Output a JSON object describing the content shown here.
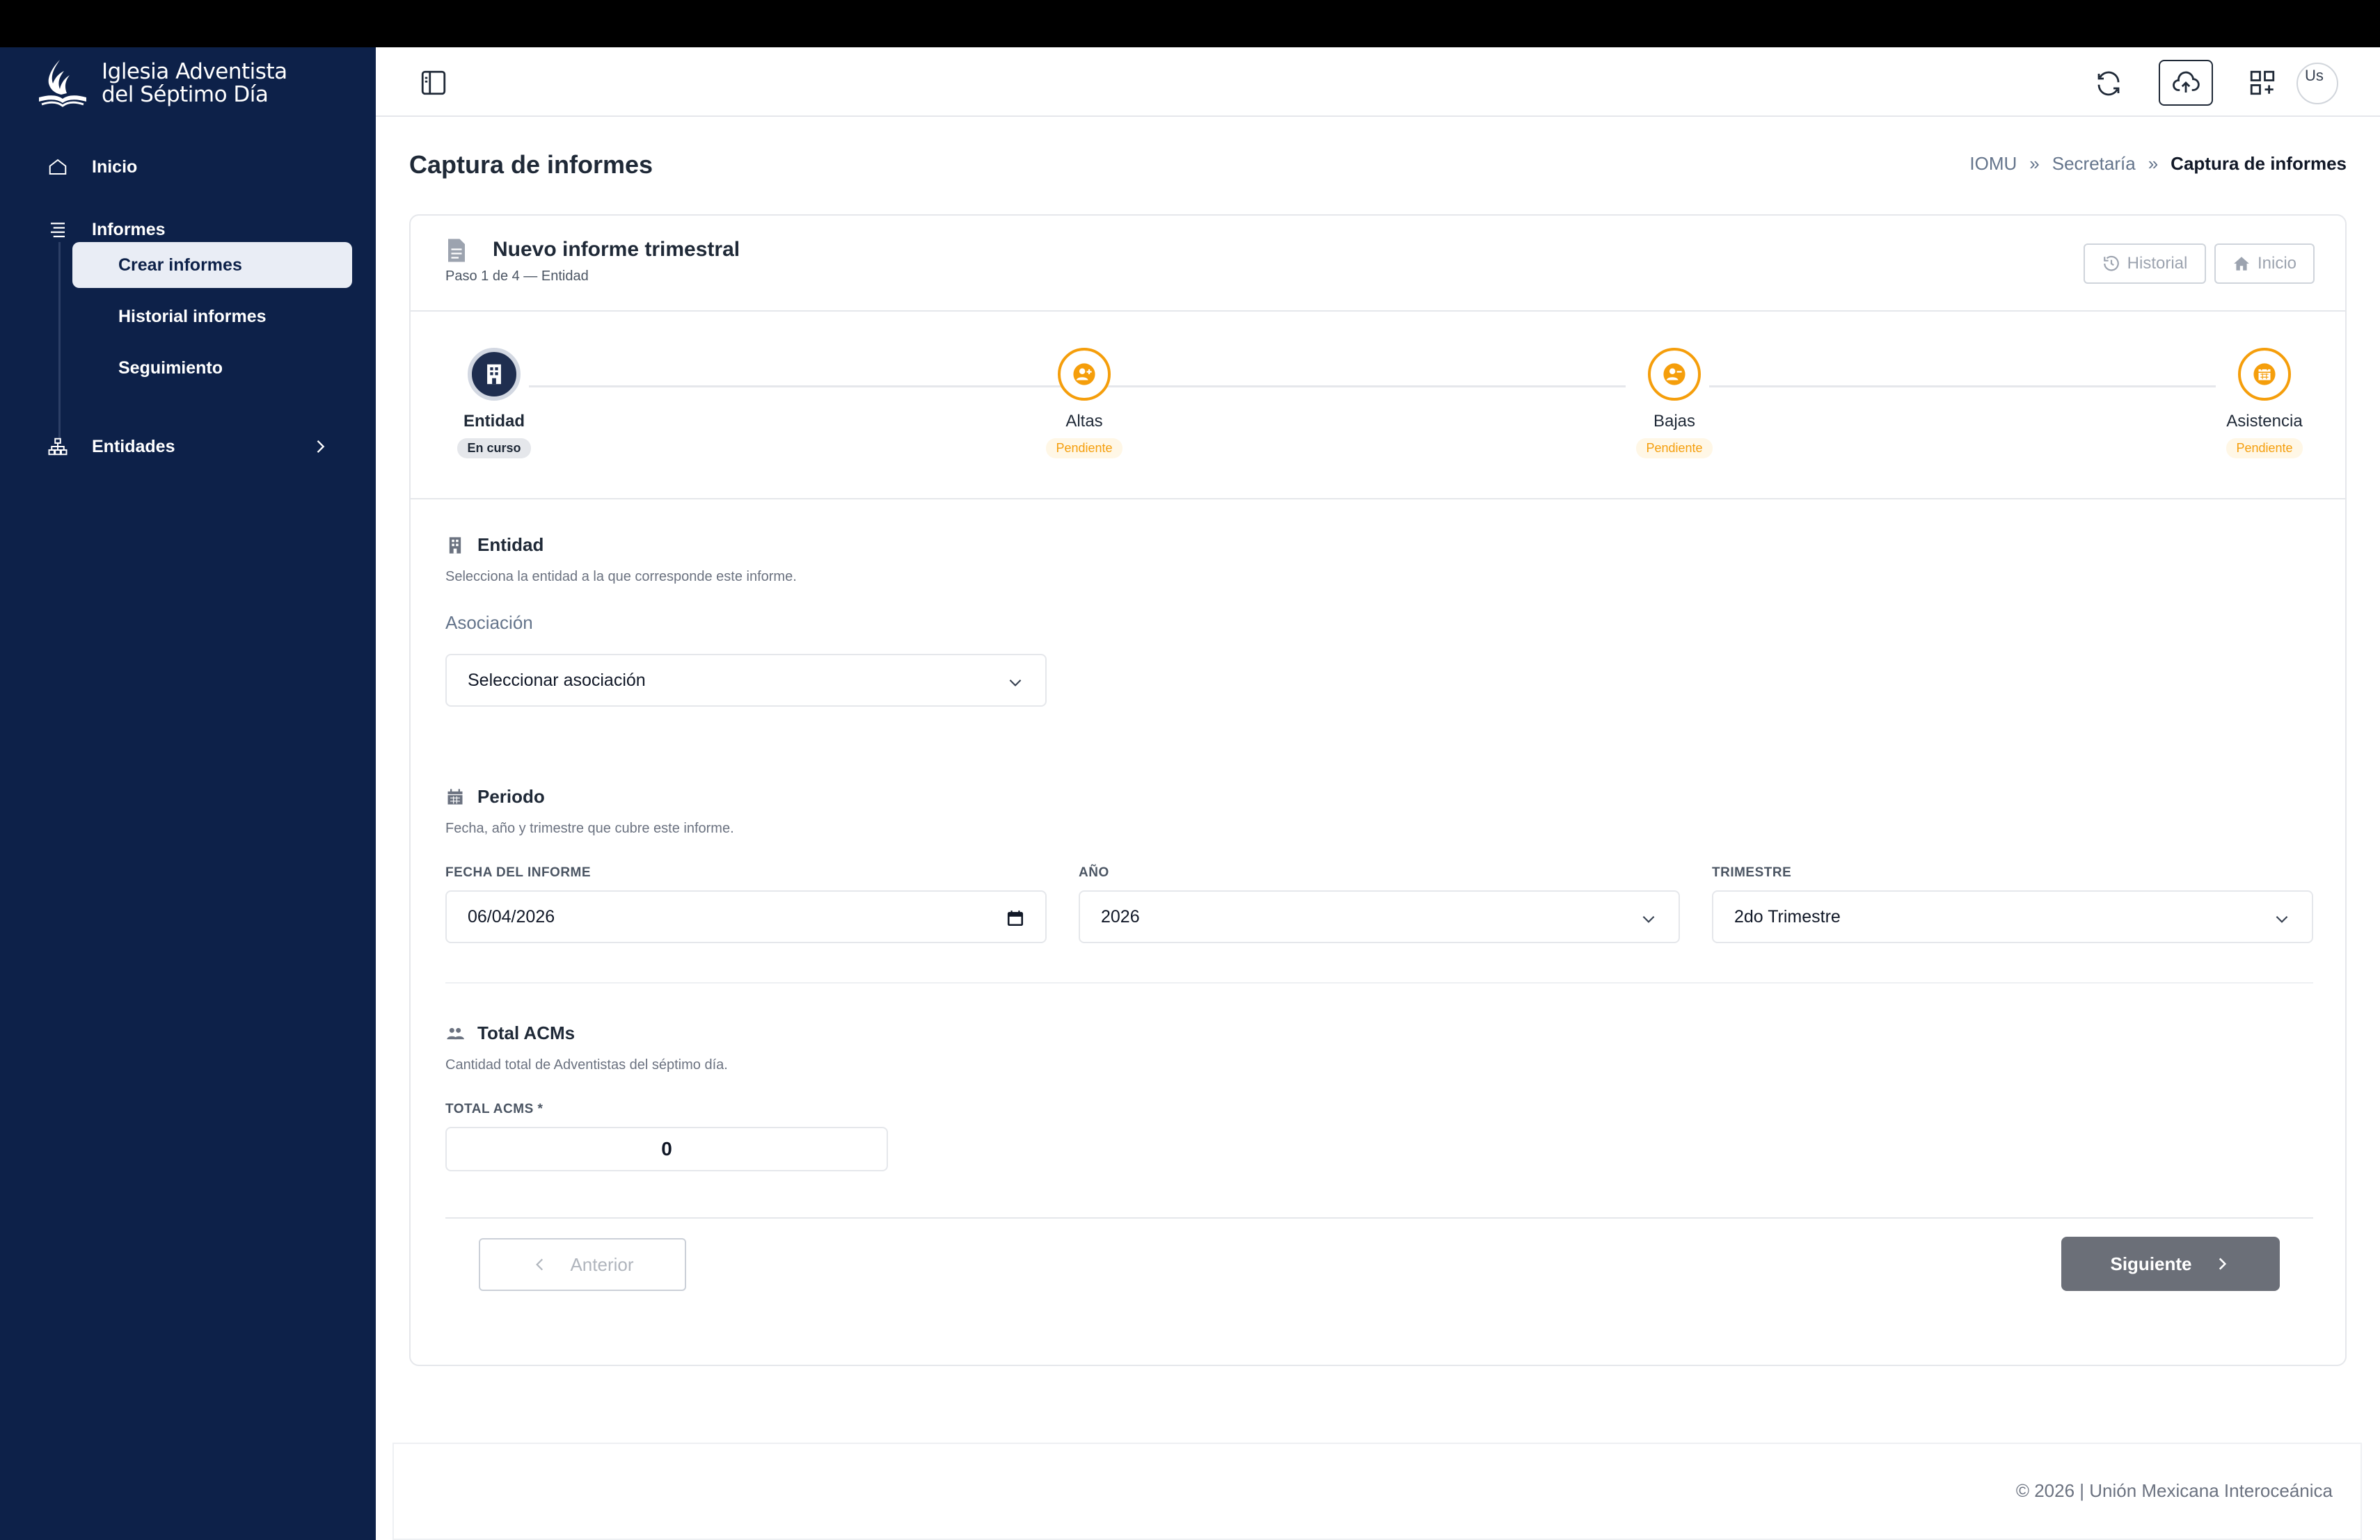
{
  "sidebar": {
    "brand_line1": "Iglesia Adventista",
    "brand_line2": "del Séptimo Día",
    "items": [
      {
        "label": "Inicio",
        "icon": "home-icon"
      },
      {
        "label": "Informes",
        "icon": "list-icon"
      },
      {
        "label": "Entidades",
        "icon": "sitemap-icon"
      }
    ],
    "sub_items": [
      {
        "label": "Crear informes",
        "active": true
      },
      {
        "label": "Historial informes",
        "active": false
      },
      {
        "label": "Seguimiento",
        "active": false
      }
    ]
  },
  "header": {
    "icons": [
      "sidebar-toggle-icon",
      "refresh-icon",
      "cloud-upload-icon",
      "apps-icon"
    ],
    "avatar_alt": "Us"
  },
  "page": {
    "title": "Captura de informes",
    "breadcrumb": [
      "IOMU",
      "Secretaría",
      "Captura de informes"
    ]
  },
  "card": {
    "title": "Nuevo informe trimestral",
    "subtitle": "Paso 1 de 4 — Entidad",
    "historial_label": "Historial",
    "inicio_label": "Inicio"
  },
  "stepper": {
    "steps": [
      {
        "label": "Entidad",
        "status": "En curso",
        "state": "current",
        "icon": "building-icon"
      },
      {
        "label": "Altas",
        "status": "Pendiente",
        "state": "pending",
        "icon": "user-plus-icon"
      },
      {
        "label": "Bajas",
        "status": "Pendiente",
        "state": "pending",
        "icon": "user-minus-icon"
      },
      {
        "label": "Asistencia",
        "status": "Pendiente",
        "state": "pending",
        "icon": "calendar-icon"
      }
    ]
  },
  "entidad": {
    "title": "Entidad",
    "description": "Selecciona la entidad a la que corresponde este informe.",
    "asociacion_label": "Asociación",
    "asociacion_value": "Seleccionar asociación"
  },
  "periodo": {
    "title": "Periodo",
    "description": "Fecha, año y trimestre que cubre este informe.",
    "fecha_label": "FECHA DEL INFORME",
    "fecha_value": "06/04/2026",
    "anio_label": "AÑO",
    "anio_value": "2026",
    "trimestre_label": "TRIMESTRE",
    "trimestre_value": "2do Trimestre"
  },
  "acms": {
    "title": "Total ACMs",
    "description": "Cantidad total de Adventistas del séptimo día.",
    "total_label": "TOTAL ACMS *",
    "total_value": "0"
  },
  "actions": {
    "prev_label": "Anterior",
    "next_label": "Siguiente"
  },
  "footer": {
    "text": "© 2026 | Unión Mexicana Interoceánica"
  },
  "colors": {
    "sidebar_bg": "#0d2149",
    "pending_accent": "#f59e0b",
    "current_step": "#1f2e4f",
    "next_button": "#6b6f78"
  }
}
